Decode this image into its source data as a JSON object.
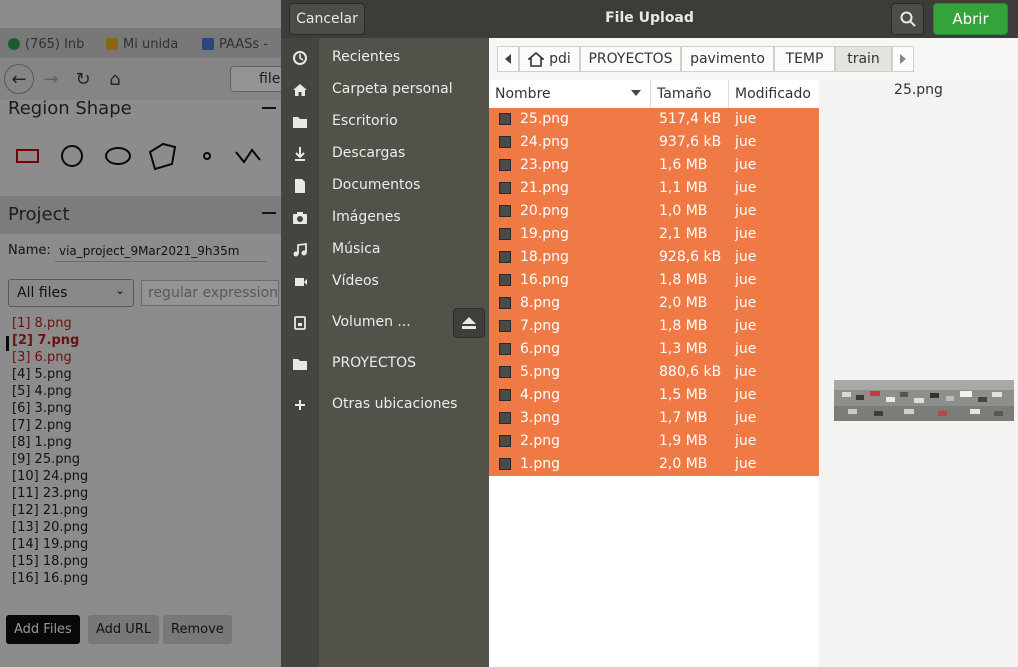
{
  "browser": {
    "tabs": [
      {
        "label": "(765) Inb",
        "color": "#2e9d54"
      },
      {
        "label": "Mi unida",
        "color": "#e8b21e"
      },
      {
        "label": "PAASs -",
        "color": "#4a79d8"
      }
    ],
    "url_text": "file"
  },
  "via": {
    "region_shape_title": "Region Shape",
    "project_title": "Project",
    "name_label": "Name:",
    "project_name": "via_project_9Mar2021_9h35m",
    "filter_select": "All files",
    "regex_placeholder": "regular expression",
    "files": [
      "[1] 8.png",
      "[2] 7.png",
      "[3] 6.png",
      "[4] 5.png",
      "[5] 4.png",
      "[6] 3.png",
      "[7] 2.png",
      "[8] 1.png",
      "[9] 25.png",
      "[10] 24.png",
      "[11] 23.png",
      "[12] 21.png",
      "[13] 20.png",
      "[14] 19.png",
      "[15] 18.png",
      "[16] 16.png"
    ],
    "add_files": "Add Files",
    "add_url": "Add URL",
    "remove": "Remove"
  },
  "dialog": {
    "title": "File Upload",
    "cancel": "Cancelar",
    "open": "Abrir",
    "places": [
      {
        "label": "Recientes",
        "icon": "clock-icon"
      },
      {
        "label": "Carpeta personal",
        "icon": "home-icon"
      },
      {
        "label": "Escritorio",
        "icon": "folder-icon"
      },
      {
        "label": "Descargas",
        "icon": "download-icon"
      },
      {
        "label": "Documentos",
        "icon": "document-icon"
      },
      {
        "label": "Imágenes",
        "icon": "camera-icon"
      },
      {
        "label": "Música",
        "icon": "music-icon"
      },
      {
        "label": "Vídeos",
        "icon": "video-icon"
      },
      {
        "label": "Volumen ...",
        "icon": "drive-icon"
      },
      {
        "label": "PROYECTOS",
        "icon": "folder-icon"
      },
      {
        "label": "Otras ubicaciones",
        "icon": "plus-icon"
      }
    ],
    "path": [
      "pdi",
      "PROYECTOS",
      "pavimento",
      "TEMP",
      "train"
    ],
    "columns": {
      "name": "Nombre",
      "size": "Tamaño",
      "modified": "Modificado"
    },
    "files": [
      {
        "name": "25.png",
        "size": "517,4 kB",
        "modified": "jue"
      },
      {
        "name": "24.png",
        "size": "937,6 kB",
        "modified": "jue"
      },
      {
        "name": "23.png",
        "size": "1,6 MB",
        "modified": "jue"
      },
      {
        "name": "21.png",
        "size": "1,1 MB",
        "modified": "jue"
      },
      {
        "name": "20.png",
        "size": "1,0 MB",
        "modified": "jue"
      },
      {
        "name": "19.png",
        "size": "2,1 MB",
        "modified": "jue"
      },
      {
        "name": "18.png",
        "size": "928,6 kB",
        "modified": "jue"
      },
      {
        "name": "16.png",
        "size": "1,8 MB",
        "modified": "jue"
      },
      {
        "name": "8.png",
        "size": "2,0 MB",
        "modified": "jue"
      },
      {
        "name": "7.png",
        "size": "1,8 MB",
        "modified": "jue"
      },
      {
        "name": "6.png",
        "size": "1,3 MB",
        "modified": "jue"
      },
      {
        "name": "5.png",
        "size": "880,6 kB",
        "modified": "jue"
      },
      {
        "name": "4.png",
        "size": "1,5 MB",
        "modified": "jue"
      },
      {
        "name": "3.png",
        "size": "1,7 MB",
        "modified": "jue"
      },
      {
        "name": "2.png",
        "size": "1,9 MB",
        "modified": "jue"
      },
      {
        "name": "1.png",
        "size": "2,0 MB",
        "modified": "jue"
      }
    ],
    "preview_name": "25.png",
    "selection_color": "#f07a45",
    "open_color": "#34a33a"
  }
}
